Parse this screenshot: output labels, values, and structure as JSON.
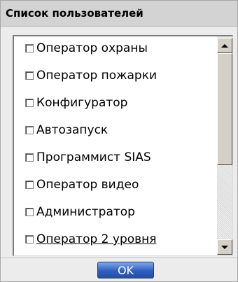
{
  "window": {
    "title": "Список пользователей"
  },
  "list": {
    "items": [
      {
        "label": "Оператор охраны",
        "checked": false
      },
      {
        "label": "Оператор пожарки",
        "checked": false
      },
      {
        "label": "Конфигуратор",
        "checked": false
      },
      {
        "label": "Автозапуск",
        "checked": false
      },
      {
        "label": "Программист SIAS",
        "checked": false
      },
      {
        "label": "Оператор видео",
        "checked": false
      },
      {
        "label": "Администратор",
        "checked": false
      },
      {
        "label": "Оператор 2 уровня",
        "checked": false
      }
    ]
  },
  "buttons": {
    "ok_label": "OK"
  },
  "icons": {
    "scroll_up": "arrow-up-icon",
    "scroll_down": "arrow-down-icon"
  },
  "colors": {
    "ok_button": "#2f5fbf",
    "titlebar": "#d3d3d3"
  }
}
